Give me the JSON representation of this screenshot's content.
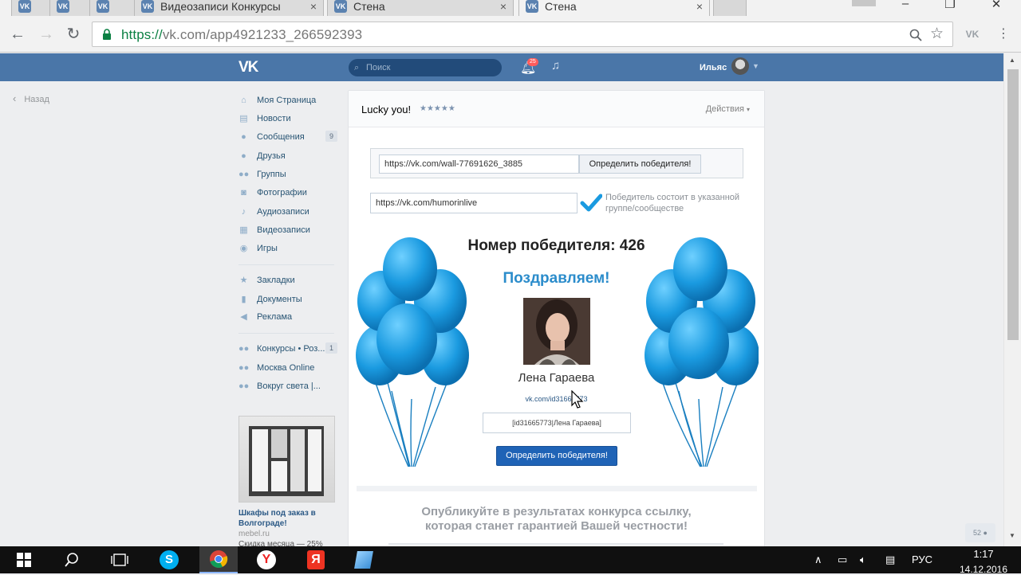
{
  "browser": {
    "tabs": [
      {
        "label": ""
      },
      {
        "label": ""
      },
      {
        "label": ""
      },
      {
        "label": "Видеозаписи Конкурсы"
      },
      {
        "label": "Стена"
      },
      {
        "label": "Стена"
      }
    ],
    "url_protocol": "https://",
    "url_rest": "vk.com/app4921233_266592393",
    "close_glyph": "×"
  },
  "vk_header": {
    "logo": "VK",
    "search_placeholder": "Поиск",
    "notification_count": "25",
    "username": "Ильяс"
  },
  "back_link": "Назад",
  "nav": {
    "items": [
      {
        "label": "Моя Страница",
        "icon": "home-icon"
      },
      {
        "label": "Новости",
        "icon": "news-icon"
      },
      {
        "label": "Сообщения",
        "icon": "messages-icon",
        "count": "9"
      },
      {
        "label": "Друзья",
        "icon": "friends-icon"
      },
      {
        "label": "Группы",
        "icon": "groups-icon"
      },
      {
        "label": "Фотографии",
        "icon": "camera-icon"
      },
      {
        "label": "Аудиозаписи",
        "icon": "music-icon"
      },
      {
        "label": "Видеозаписи",
        "icon": "video-icon"
      },
      {
        "label": "Игры",
        "icon": "games-icon"
      }
    ],
    "items2": [
      {
        "label": "Закладки",
        "icon": "star-icon"
      },
      {
        "label": "Документы",
        "icon": "document-icon"
      },
      {
        "label": "Реклама",
        "icon": "ads-icon"
      }
    ],
    "items3": [
      {
        "label": "Конкурсы • Роз...",
        "icon": "community-icon",
        "count": "1"
      },
      {
        "label": "Москва Online",
        "icon": "community-icon"
      },
      {
        "label": "Вокруг света |...",
        "icon": "community-icon"
      }
    ]
  },
  "ad": {
    "title": "Шкафы под заказ в Волгограде!",
    "domain": "mebel.ru",
    "desc": "Скидка месяца — 25%"
  },
  "app": {
    "name": "Lucky you!",
    "stars": "★★★★★",
    "actions": "Действия",
    "post_url": "https://vk.com/wall-77691626_3885",
    "detect_button": "Определить победителя!",
    "group_url": "https://vk.com/humorinlive",
    "group_note": "Победитель состоит в указанной группе/сообществе",
    "winner_number": "Номер победителя: 426",
    "congrats": "Поздравляем!",
    "winner_name": "Лена Гараева",
    "winner_link": "vk.com/id31665773",
    "winner_mention": "[id31665773|Лена Гараева]",
    "detect_button2": "Определить победителя!",
    "publish_note_1": "Опубликуйте в результатах конкурса ссылку,",
    "publish_note_2": "которая станет гарантией Вашей честности!"
  },
  "chat_count": "52",
  "taskbar": {
    "lang": "РУС",
    "time": "1:17",
    "date": "14.12.2016"
  },
  "colors": {
    "vk_blue": "#4a76a8",
    "balloon_blue": "#1a9ae0",
    "congrats_blue": "#2b8ccb",
    "button_blue": "#1f63b6"
  }
}
